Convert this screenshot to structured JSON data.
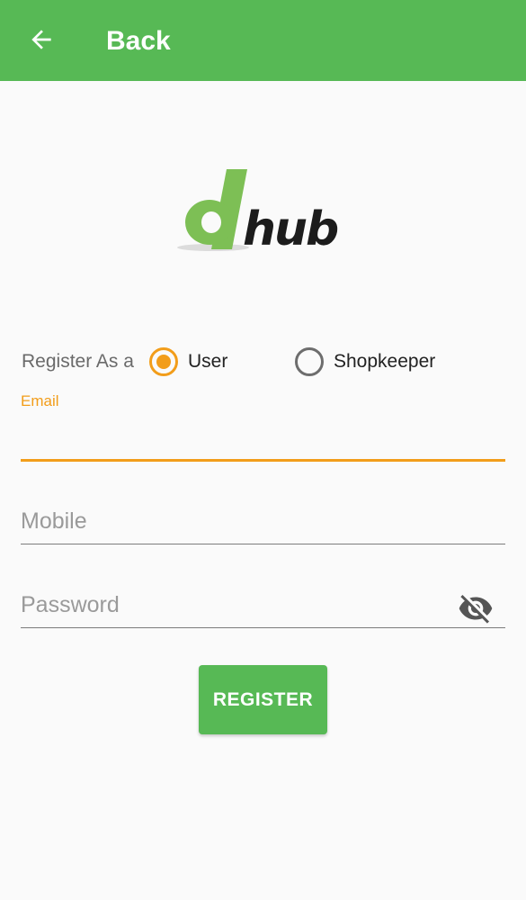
{
  "appbar": {
    "back_icon": "arrow-left-icon",
    "title": "Back"
  },
  "logo": {
    "text": "hub"
  },
  "register_as": {
    "label": "Register As a",
    "options": [
      {
        "label": "User",
        "checked": true
      },
      {
        "label": "Shopkeeper",
        "checked": false
      }
    ]
  },
  "form": {
    "email": {
      "label": "Email",
      "value": ""
    },
    "mobile": {
      "placeholder": "Mobile",
      "value": ""
    },
    "password": {
      "placeholder": "Password",
      "value": "",
      "visibility_icon": "eye-off-icon"
    }
  },
  "register_button": {
    "label": "REGISTER"
  },
  "colors": {
    "primary_green": "#57b955",
    "accent_orange": "#f29d1a",
    "logo_green": "#7dbf55",
    "background": "#fafafa"
  }
}
